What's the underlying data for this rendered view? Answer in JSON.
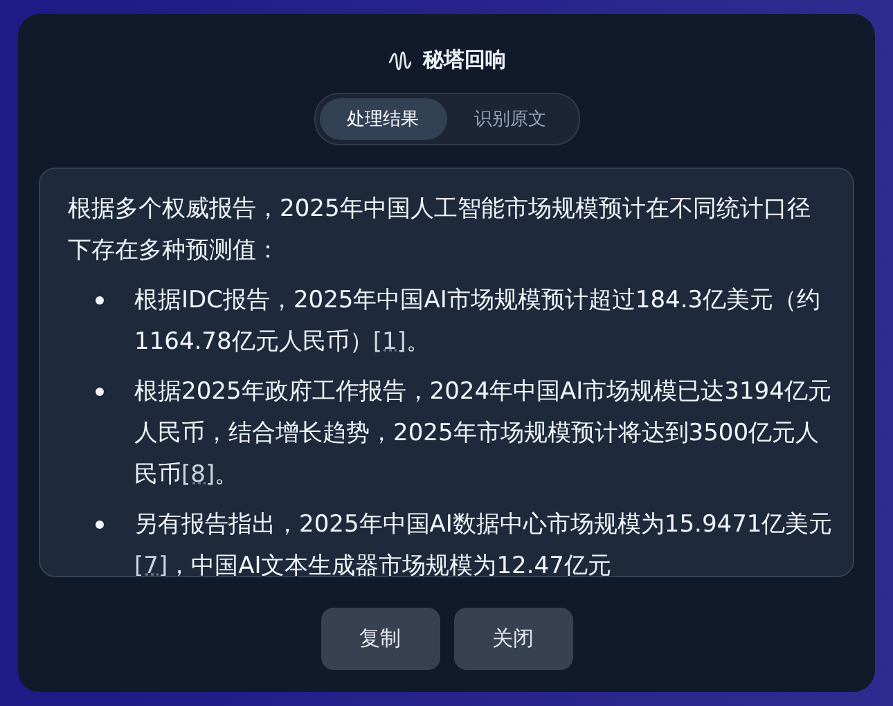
{
  "dialog": {
    "title": "秘塔回响",
    "tabs": [
      {
        "label": "处理结果",
        "selected": true
      },
      {
        "label": "识别原文",
        "selected": false
      }
    ],
    "content": {
      "intro": "根据多个权威报告，2025年中国人工智能市场规模预计在不同统计口径下存在多种预测值：",
      "bullets": [
        {
          "parts": [
            {
              "kind": "text",
              "text": "根据IDC报告，2025年中国AI市场规模预计超过184.3亿美元（约1164.78亿元人民币）"
            },
            {
              "kind": "cite",
              "text": "[1]"
            },
            {
              "kind": "text",
              "text": "。"
            }
          ]
        },
        {
          "parts": [
            {
              "kind": "text",
              "text": "根据2025年政府工作报告，2024年中国AI市场规模已达3194亿元人民币，结合增长趋势，2025年市场规模预计将达到3500亿元人民币"
            },
            {
              "kind": "cite",
              "text": "[8]"
            },
            {
              "kind": "text",
              "text": "。"
            }
          ]
        },
        {
          "parts": [
            {
              "kind": "text",
              "text": "另有报告指出，2025年中国AI数据中心市场规模为15.9471亿美元"
            },
            {
              "kind": "cite",
              "text": "[7]"
            },
            {
              "kind": "text",
              "text": "，中国AI文本生成器市场规模为12.47亿元"
            }
          ]
        }
      ]
    },
    "buttons": [
      "复制",
      "关闭"
    ]
  }
}
